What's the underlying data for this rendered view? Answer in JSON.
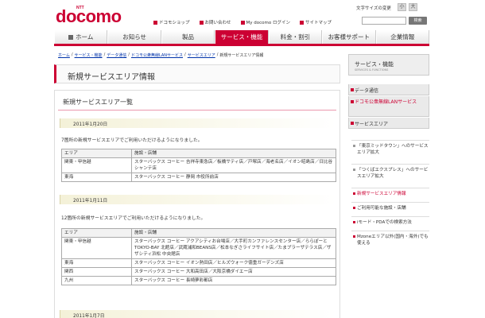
{
  "header": {
    "logo_top": "NTT",
    "logo": "docomo",
    "font_size_label": "文字サイズの変更",
    "font_buttons": [
      "小",
      "大"
    ],
    "util_links": [
      "ドコモショップ",
      "お問い合わせ",
      "My docomo ログイン",
      "サイトマップ"
    ],
    "search_button": "検索"
  },
  "nav": {
    "items": [
      "ホーム",
      "お知らせ",
      "製品",
      "サービス・機能",
      "料金・割引",
      "お客様サポート",
      "企業情報"
    ],
    "active_index": 3
  },
  "breadcrumb": [
    "ホーム",
    "サービス・機能",
    "データ通信",
    "ドコモ公衆無線LANサービス",
    "サービスエリア",
    "新規サービスエリア情報"
  ],
  "page_title": "新規サービスエリア情報",
  "main": {
    "section_heading": "新規サービスエリア一覧",
    "blocks": [
      {
        "date": "2011年1月20日",
        "intro": "7箇所の新規サービスエリアでご利用いただけるようになりました。",
        "table": {
          "headers": [
            "エリア",
            "施設・店舗"
          ],
          "rows": [
            [
              "関東・甲信越",
              "スターバックス コーヒー 吉祥寺東急店／板橋サティ店／戸塚店／海老名店／イオン昭島店／日比谷シャンテ店"
            ],
            [
              "東海",
              "スターバックス コーヒー 静岡 市役所前店"
            ]
          ]
        }
      },
      {
        "date": "2011年1月11日",
        "intro": "12箇所の新規サービスエリアでご利用いただけるようになりました。",
        "table": {
          "headers": [
            "エリア",
            "施設・店舗"
          ],
          "rows": [
            [
              "関東・甲信越",
              "スターバックス コーヒー アクアシティお台場店／大手町カンファレンスセンター店／ららぽーとTOKYO-BAY 北館店／武蔵浦和BEANS店／松本なぎさライフサイト店／たまプラーザテラス店／ザザシティ浜松 中央館店"
            ],
            [
              "東海",
              "スターバックス コーヒー イオン熱田店／ヒルズウォーク徳重ガーデンズ店"
            ],
            [
              "関西",
              "スターバックス コーヒー 大和高田店／大阪京橋ダイエー店"
            ],
            [
              "九州",
              "スターバックス コーヒー 長崎夢彩都店"
            ]
          ]
        }
      },
      {
        "date": "2011年1月7日"
      }
    ]
  },
  "sidebar": {
    "title": "サービス・機能",
    "subtitle": "SERVICES & FUNCTIONS",
    "categories": [
      "データ通信",
      "ドコモ公衆無線LANサービス",
      "サービスエリア"
    ],
    "items": [
      "「東京ミッドタウン」へのサービスエリア拡大",
      "「つくばエクスプレス」へのサービスエリア拡大",
      "新規サービスエリア情報",
      "ご利用可能な施設・店舗",
      "iモード・PDAでの検索方法",
      "Mzoneエリア以外(国内・海外)でも使える"
    ],
    "active_item_index": 2
  },
  "colors": {
    "brand": "#cc0033",
    "link": "#0033aa",
    "date_bar": "#f4f1d8"
  }
}
